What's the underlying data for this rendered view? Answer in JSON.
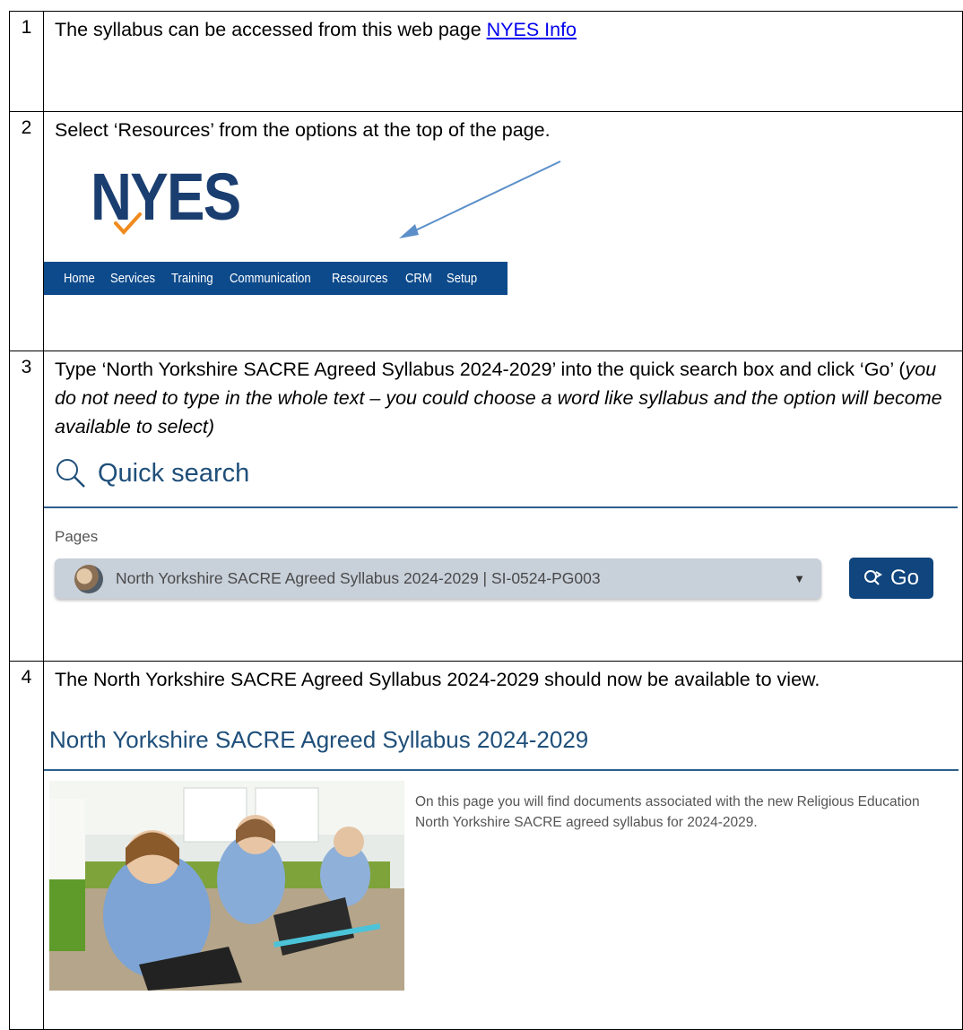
{
  "rows": [
    {
      "number": "1",
      "text_prefix": "The syllabus can be accessed from this web page ",
      "link_text": "NYES Info"
    },
    {
      "number": "2",
      "text": "Select ‘Resources’ from the options at the top of the page.",
      "logo_text": "NYES",
      "nav_items": [
        "Home",
        "Services",
        "Training",
        "Communication",
        "Resources",
        "CRM",
        "Setup"
      ]
    },
    {
      "number": "3",
      "text_main": "Type ‘North Yorkshire SACRE Agreed Syllabus 2024-2029’ into the quick search box and click ‘Go’ (",
      "text_italic": "you do not need to type in the whole text – you could choose a word like syllabus and the option will become available to select)",
      "quick_search_title": "Quick search",
      "pages_label": "Pages",
      "selected_page": "North Yorkshire SACRE Agreed Syllabus 2024-2029 | SI-0524-PG003",
      "go_label": "Go"
    },
    {
      "number": "4",
      "text": "The North Yorkshire SACRE Agreed Syllabus 2024-2029 should now be available to view.",
      "page_title": "North Yorkshire SACRE Agreed Syllabus 2024-2029",
      "description": "On this page you will find documents associated with the new Religious Education North Yorkshire SACRE agreed syllabus for 2024-2029."
    }
  ],
  "colors": {
    "nav_bar": "#0d4a8b",
    "logo": "#1a3e70",
    "tick": "#f08a1c",
    "go_button": "#10457d",
    "heading": "#1f4f7a",
    "link": "#0000ee"
  }
}
